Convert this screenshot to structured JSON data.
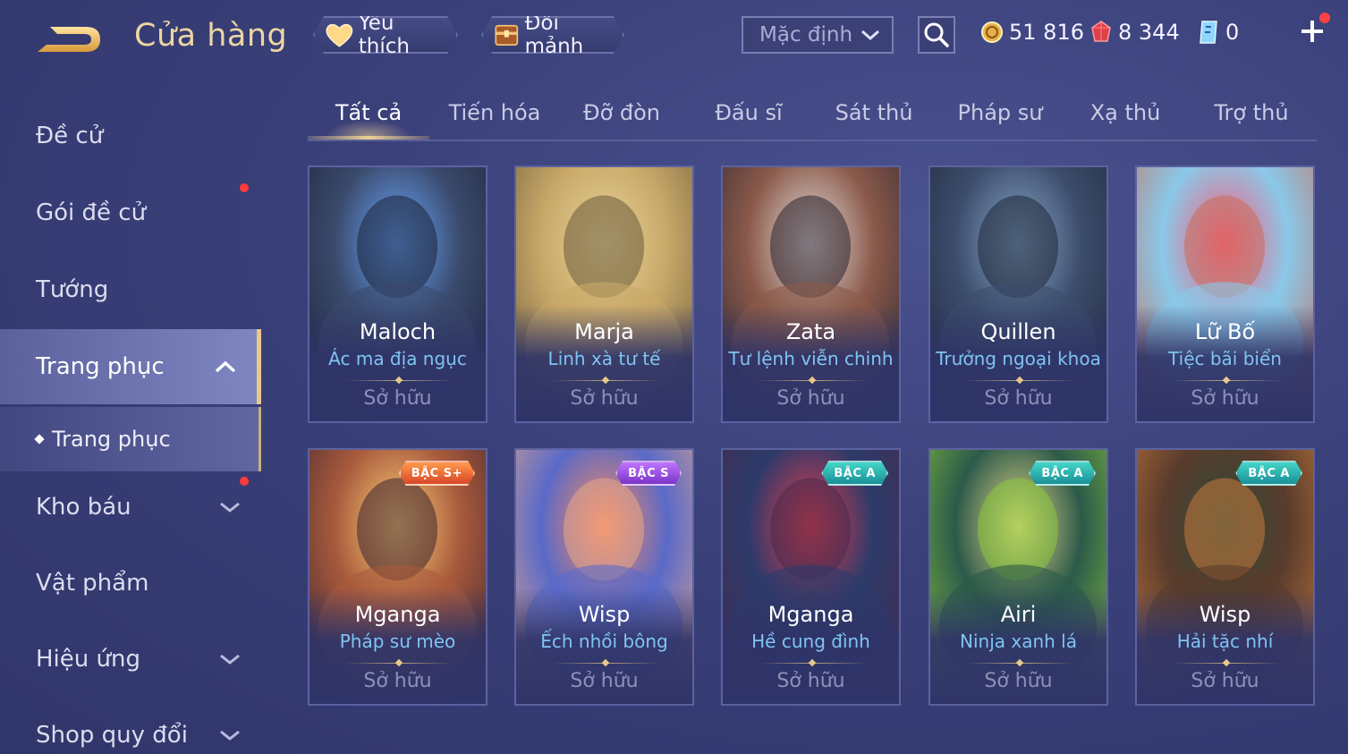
{
  "header": {
    "title": "Cửa hàng",
    "favorite_label": "Yêu thích",
    "shard_label": "Đổi mảnh",
    "sort": {
      "selected": "Mặc định"
    }
  },
  "currencies": {
    "gold": "51 816",
    "ruby": "8 344",
    "voucher": "0"
  },
  "sidebar": {
    "items": [
      {
        "label": "Đề cử"
      },
      {
        "label": "Gói đề cử"
      },
      {
        "label": "Tướng"
      },
      {
        "label": "Trang phục"
      },
      {
        "label": "Kho báu"
      },
      {
        "label": "Vật phẩm"
      },
      {
        "label": "Hiệu ứng"
      },
      {
        "label": "Shop quy đổi"
      }
    ],
    "sub_item": "Trang phục"
  },
  "tabs": [
    "Tất cả",
    "Tiến hóa",
    "Đỡ đòn",
    "Đấu sĩ",
    "Sát thủ",
    "Pháp sư",
    "Xạ thủ",
    "Trợ thủ"
  ],
  "cards": [
    {
      "hero": "Maloch",
      "skin": "Ác ma địa ngục",
      "status": "Sở hữu",
      "tier": "",
      "art": "maloch"
    },
    {
      "hero": "Marja",
      "skin": "Linh xà tư tế",
      "status": "Sở hữu",
      "tier": "",
      "art": "marja"
    },
    {
      "hero": "Zata",
      "skin": "Tư lệnh viễn chinh",
      "status": "Sở hữu",
      "tier": "",
      "art": "zata"
    },
    {
      "hero": "Quillen",
      "skin": "Trưởng ngoại khoa",
      "status": "Sở hữu",
      "tier": "",
      "art": "quillen"
    },
    {
      "hero": "Lữ Bố",
      "skin": "Tiệc bãi biển",
      "status": "Sở hữu",
      "tier": "",
      "art": "lubo"
    },
    {
      "hero": "Mganga",
      "skin": "Pháp sư mèo",
      "status": "Sở hữu",
      "tier": "BẬC S+",
      "art": "mganga-cat"
    },
    {
      "hero": "Wisp",
      "skin": "Ếch nhồi bông",
      "status": "Sở hữu",
      "tier": "BẬC S",
      "art": "wisp-frog"
    },
    {
      "hero": "Mganga",
      "skin": "Hề cung đình",
      "status": "Sở hữu",
      "tier": "BẬC A",
      "art": "mganga-jester"
    },
    {
      "hero": "Airi",
      "skin": "Ninja xanh lá",
      "status": "Sở hữu",
      "tier": "BẬC A",
      "art": "airi"
    },
    {
      "hero": "Wisp",
      "skin": "Hải tặc nhí",
      "status": "Sở hữu",
      "tier": "BẬC A",
      "art": "wisp-pirate"
    }
  ]
}
